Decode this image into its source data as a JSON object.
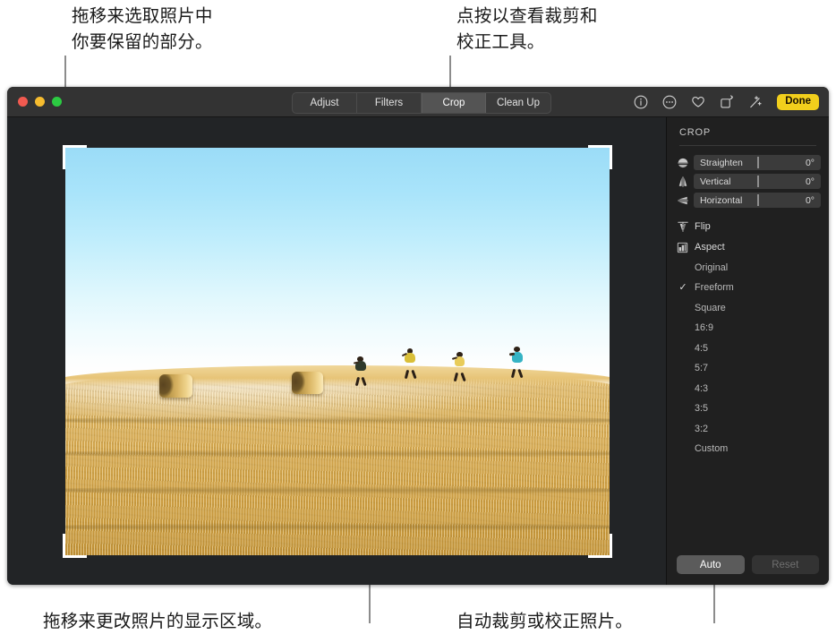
{
  "annotations": {
    "top_left": "拖移来选取照片中\n你要保留的部分。",
    "top_center": "点按以查看裁剪和\n校正工具。",
    "bottom_left": "拖移来更改照片的显示区域。",
    "bottom_right": "自动裁剪或校正照片。"
  },
  "window": {
    "traffic_lights": [
      "close-red",
      "minimize-yellow",
      "zoom-green"
    ],
    "tabs": [
      {
        "label": "Adjust",
        "active": false
      },
      {
        "label": "Filters",
        "active": false
      },
      {
        "label": "Crop",
        "active": true
      },
      {
        "label": "Clean Up",
        "active": false
      }
    ],
    "toolbar_icons": [
      {
        "name": "info-icon"
      },
      {
        "name": "more-options-icon"
      },
      {
        "name": "favorite-heart-icon"
      },
      {
        "name": "rotate-icon"
      },
      {
        "name": "auto-enhance-wand-icon"
      }
    ],
    "done_label": "Done"
  },
  "inspector": {
    "title": "CROP",
    "sliders": [
      {
        "icon": "straighten-icon",
        "label": "Straighten",
        "value": "0°"
      },
      {
        "icon": "vertical-perspective-icon",
        "label": "Vertical",
        "value": "0°"
      },
      {
        "icon": "horizontal-perspective-icon",
        "label": "Horizontal",
        "value": "0°"
      }
    ],
    "menus": [
      {
        "icon": "flip-icon",
        "label": "Flip"
      },
      {
        "icon": "aspect-grid-icon",
        "label": "Aspect"
      }
    ],
    "aspect_options": [
      {
        "label": "Original",
        "selected": false
      },
      {
        "label": "Freeform",
        "selected": true
      },
      {
        "label": "Square",
        "selected": false
      },
      {
        "label": "16:9",
        "selected": false
      },
      {
        "label": "4:5",
        "selected": false
      },
      {
        "label": "5:7",
        "selected": false
      },
      {
        "label": "4:3",
        "selected": false
      },
      {
        "label": "3:5",
        "selected": false
      },
      {
        "label": "3:2",
        "selected": false
      },
      {
        "label": "Custom",
        "selected": false
      }
    ],
    "check_glyph": "✓",
    "auto_label": "Auto",
    "reset_label": "Reset"
  },
  "photo": {
    "description": "Four people running along the crest of a golden harvested wheat field with two round hay bales, bright blue sky above",
    "colors": {
      "sky_top": "#9bdcf7",
      "horizon": "#ffffff",
      "field_light": "#e9c887",
      "field_dark": "#c19136",
      "bale_dark": "#5a4420"
    }
  },
  "theme": {
    "accent_done": "#f2cf1c",
    "window_bg": "#1e1e1e",
    "titlebar_bg": "#333333",
    "canvas_bg": "#222426",
    "sidebar_bg": "#202020",
    "leader_line": "#8c8c8c"
  }
}
